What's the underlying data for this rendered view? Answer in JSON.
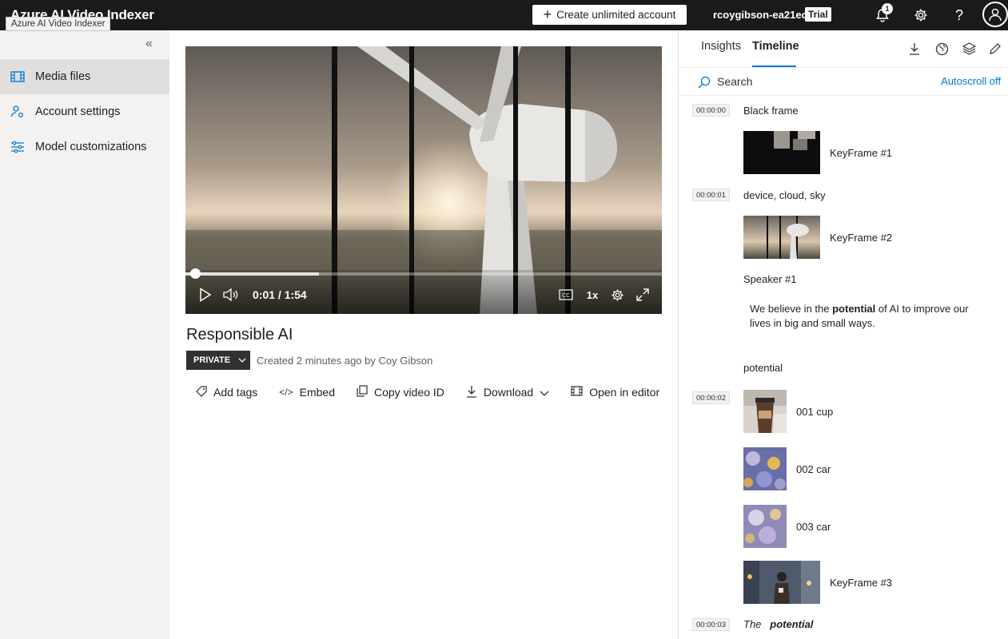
{
  "header": {
    "app_title": "Azure AI Video Indexer",
    "tooltip": "Azure AI Video Indexer",
    "create_button": "Create unlimited account",
    "account_name": "rcoygibson-ea21ec",
    "account_badge": "Trial",
    "notification_count": "1"
  },
  "sidebar": {
    "items": [
      {
        "label": "Media files",
        "icon": "film-icon",
        "active": true
      },
      {
        "label": "Account settings",
        "icon": "person-settings-icon",
        "active": false
      },
      {
        "label": "Model customizations",
        "icon": "sliders-icon",
        "active": false
      }
    ]
  },
  "player": {
    "time": "0:01 / 1:54",
    "speed": "1x",
    "progress_fraction": 0.009,
    "buffered_fraction": 0.28
  },
  "video": {
    "title": "Responsible AI",
    "visibility": "PRIVATE",
    "created": "Created 2 minutes ago by Coy Gibson",
    "actions": {
      "add_tags": "Add tags",
      "embed": "Embed",
      "copy_id": "Copy video ID",
      "download": "Download",
      "open_editor": "Open in editor"
    }
  },
  "panel": {
    "tabs": {
      "insights": "Insights",
      "timeline": "Timeline"
    },
    "search_placeholder": "Search",
    "autoscroll": "Autoscroll off",
    "timeline": {
      "ts0": "00:00:00",
      "ts1": "00:00:01",
      "ts2": "00:00:02",
      "ts3": "00:00:03",
      "black_frame": "Black frame",
      "kf1": "KeyFrame #1",
      "labels": "device, cloud, sky",
      "kf2": "KeyFrame #2",
      "speaker": "Speaker #1",
      "transcript_pre": "We believe in the ",
      "transcript_bold": "potential",
      "transcript_post": " of AI to improve our lives in big and small ways.",
      "keyword": "potential",
      "obj1": "001 cup",
      "obj2": "002 car",
      "obj3": "003 car",
      "kf3": "KeyFrame #3",
      "last_pre": "The",
      "last_bold": "potential"
    }
  },
  "colors": {
    "topbar": "#1b1a19",
    "accent": "#0078d4",
    "sidebar": "#f3f2f1"
  }
}
